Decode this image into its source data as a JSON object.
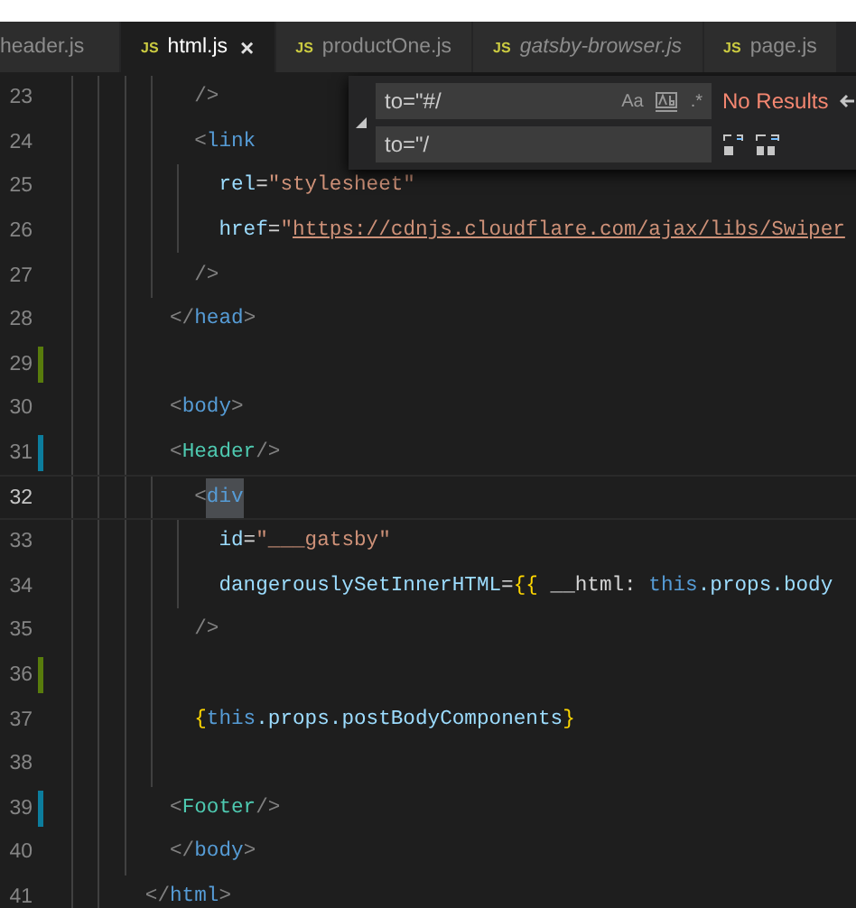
{
  "tabs": [
    {
      "label": "header.js",
      "selected": false,
      "preview": false
    },
    {
      "label": "html.js",
      "icon": "JS",
      "selected": true,
      "preview": false,
      "close": "×"
    },
    {
      "label": "productOne.js",
      "icon": "JS",
      "selected": false,
      "preview": false
    },
    {
      "label": "gatsby-browser.js",
      "icon": "JS",
      "selected": false,
      "preview": true
    },
    {
      "label": "page.js",
      "icon": "JS",
      "selected": false,
      "preview": false
    }
  ],
  "find_widget": {
    "find_value": "to=\"#/",
    "replace_value": "to=\"/",
    "options": [
      {
        "kind": "text",
        "label": "Aa"
      },
      {
        "kind": "whole-word"
      },
      {
        "kind": "text",
        "label": ".*"
      }
    ],
    "result": "No Results"
  },
  "lines": [
    {
      "children": [
        {
          "children": [
            {
              "number": "23",
              "current": false,
              "tokens": [
                {
                  "kind": "punct",
                  "text": "/>"
                }
              ]
            },
            {
              "number": "24",
              "current": false,
              "tokens": [
                {
                  "kind": "punct",
                  "text": "<"
                },
                {
                  "kind": "tag",
                  "text": "link"
                }
              ],
              "children": [
                {
                  "number": "25",
                  "current": false,
                  "tokens": [
                    {
                      "kind": "attr",
                      "text": "rel"
                    },
                    {
                      "kind": "plain",
                      "text": "="
                    },
                    {
                      "kind": "string",
                      "text": "\"stylesheet\""
                    }
                  ]
                },
                {
                  "number": "26",
                  "current": false,
                  "tokens": [
                    {
                      "kind": "attr",
                      "text": "href"
                    },
                    {
                      "kind": "plain",
                      "text": "="
                    },
                    {
                      "kind": "string",
                      "text": "\""
                    },
                    {
                      "kind": "link",
                      "text": "https://cdnjs.cloudflare.com/ajax/libs/Swiper"
                    }
                  ]
                }
              ]
            },
            {
              "number": "27",
              "current": false,
              "tokens": [
                {
                  "kind": "punct",
                  "text": "/>"
                }
              ]
            }
          ]
        },
        {
          "number": "28",
          "current": false,
          "tokens": [
            {
              "kind": "punct",
              "text": "</"
            },
            {
              "kind": "tag",
              "text": "head"
            },
            {
              "kind": "punct",
              "text": ">"
            }
          ]
        },
        {
          "number": "29",
          "kind": "added",
          "current": false
        },
        {
          "number": "30",
          "current": false,
          "tokens": [
            {
              "kind": "punct",
              "text": "<"
            },
            {
              "kind": "tag",
              "text": "body"
            },
            {
              "kind": "punct",
              "text": ">"
            }
          ]
        },
        {
          "number": "31",
          "kind": "modified",
          "current": false,
          "tokens": [
            {
              "kind": "punct",
              "text": "<"
            },
            {
              "kind": "component",
              "text": "Header"
            },
            {
              "kind": "punct",
              "text": "/>"
            }
          ]
        },
        {
          "children": [
            {
              "number": "32",
              "current": true,
              "tokens": [
                {
                  "kind": "punct",
                  "text": "<"
                },
                {
                  "kind": "tag-selected",
                  "text": "div"
                }
              ],
              "children": [
                {
                  "number": "33",
                  "current": false,
                  "tokens": [
                    {
                      "kind": "attr",
                      "text": "id"
                    },
                    {
                      "kind": "plain",
                      "text": "="
                    },
                    {
                      "kind": "string",
                      "text": "\"___gatsby\""
                    }
                  ]
                },
                {
                  "number": "34",
                  "current": false,
                  "tokens": [
                    {
                      "kind": "attr",
                      "text": "dangerouslySetInnerHTML"
                    },
                    {
                      "kind": "plain",
                      "text": "="
                    },
                    {
                      "kind": "brace",
                      "text": "{{"
                    },
                    {
                      "kind": "plain",
                      "text": " __html: "
                    },
                    {
                      "kind": "keyword",
                      "text": "this"
                    },
                    {
                      "kind": "attr",
                      "text": ".props.body"
                    }
                  ]
                }
              ]
            },
            {
              "number": "35",
              "current": false,
              "tokens": [
                {
                  "kind": "punct",
                  "text": "/>"
                }
              ]
            },
            {
              "number": "36",
              "kind": "added",
              "current": false
            },
            {
              "number": "37",
              "current": false,
              "tokens": [
                {
                  "kind": "brace",
                  "text": "{"
                },
                {
                  "kind": "keyword",
                  "text": "this"
                },
                {
                  "kind": "attr",
                  "text": ".props.postBodyComponents"
                },
                {
                  "kind": "brace",
                  "text": "}"
                }
              ]
            },
            {
              "number": "38",
              "current": false
            }
          ]
        },
        {
          "number": "39",
          "kind": "modified",
          "current": false,
          "tokens": [
            {
              "kind": "punct",
              "text": "<"
            },
            {
              "kind": "component",
              "text": "Footer"
            },
            {
              "kind": "punct",
              "text": "/>"
            }
          ]
        },
        {
          "number": "40",
          "current": false,
          "tokens": [
            {
              "kind": "punct",
              "text": "</"
            },
            {
              "kind": "tag",
              "text": "body"
            },
            {
              "kind": "punct",
              "text": ">"
            }
          ]
        }
      ]
    },
    {
      "number": "41",
      "current": false,
      "tokens": [
        {
          "kind": "punct",
          "text": "</"
        },
        {
          "kind": "tag",
          "text": "html"
        },
        {
          "kind": "punct",
          "text": ">"
        }
      ]
    }
  ]
}
